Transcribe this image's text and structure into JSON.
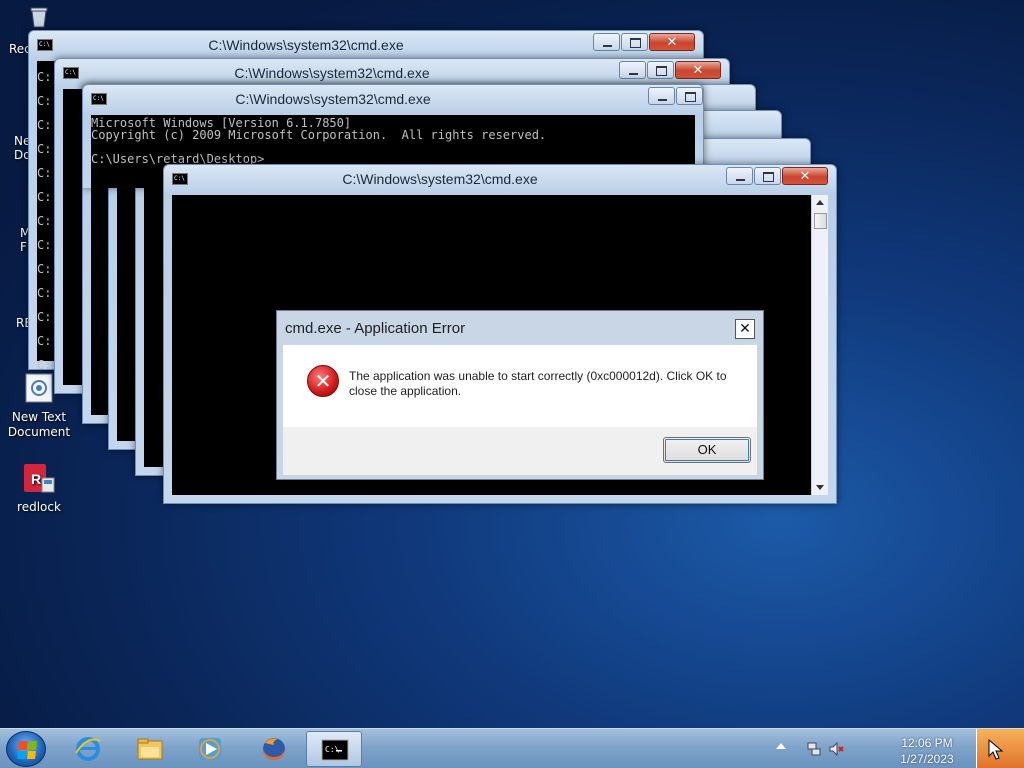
{
  "desktop": {
    "icons": [
      {
        "label": "Recycle Bin",
        "visible": "Rec"
      },
      {
        "label": "New Document",
        "visible": "Ne\nDo"
      },
      {
        "label": "Mozilla Firefox",
        "visible": "M\nF"
      },
      {
        "label": "RE",
        "visible": "RE"
      },
      {
        "label": "New Text Document"
      },
      {
        "label": "redlock"
      }
    ]
  },
  "windows": {
    "title": "C:\\Windows\\system32\\cmd.exe",
    "console_lines": "Microsoft Windows [Version 6.1.7850]\nCopyright (c) 2009 Microsoft Corporation.  All rights reserved.\n\nC:\\Users\\retard\\Desktop>_",
    "prompt_fragment": "C:"
  },
  "dialog": {
    "title": "cmd.exe - Application Error",
    "message": "The application was unable to start correctly (0xc000012d). Click OK to close the application.",
    "ok_label": "OK",
    "close_label": "✕"
  },
  "taskbar": {
    "time": "12:06 PM",
    "date": "1/27/2023",
    "pinned": [
      "internet-explorer",
      "windows-explorer",
      "windows-media-player",
      "firefox",
      "cmd"
    ]
  },
  "colors": {
    "desktop_bg": "#10397c",
    "close_button": "#c9442c",
    "error_icon": "#d01818"
  }
}
